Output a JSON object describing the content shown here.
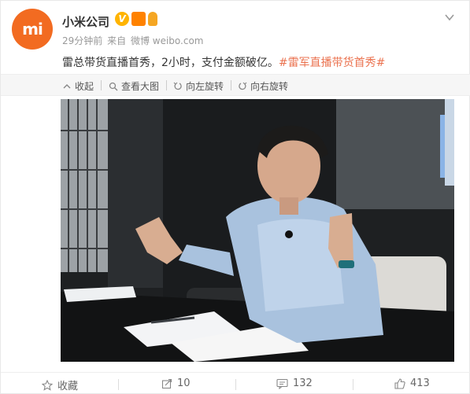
{
  "post": {
    "author": "小米公司",
    "avatar_logo": "mi",
    "time": "29分钟前",
    "source_prefix": "来自",
    "source": "微博 weibo.com",
    "text": "雷总带货直播首秀，2小时，支付金额破亿。",
    "hashtag": "#雷军直播带货首秀#"
  },
  "image_toolbar": {
    "collapse": "收起",
    "view_large": "查看大图",
    "rotate_left": "向左旋转",
    "rotate_right": "向右旋转"
  },
  "actions": {
    "favorite": "收藏",
    "repost": "10",
    "comment": "132",
    "like": "413"
  },
  "colors": {
    "brand": "#f26b21",
    "hashtag": "#eb7350",
    "badge": "#ffb400"
  }
}
